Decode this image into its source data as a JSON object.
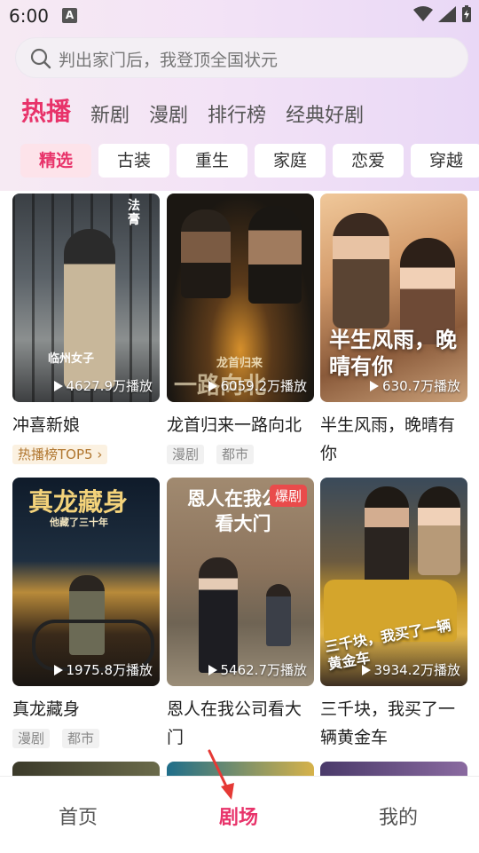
{
  "status_bar": {
    "time": "6:00",
    "notification_icon": "A"
  },
  "search": {
    "placeholder": "判出家门后，我登顶全国状元"
  },
  "tabs": [
    {
      "label": "热播",
      "active": true
    },
    {
      "label": "新剧"
    },
    {
      "label": "漫剧"
    },
    {
      "label": "排行榜"
    },
    {
      "label": "经典好剧"
    }
  ],
  "chips": [
    {
      "label": "精选",
      "active": true
    },
    {
      "label": "古装"
    },
    {
      "label": "重生"
    },
    {
      "label": "家庭"
    },
    {
      "label": "恋爱"
    },
    {
      "label": "穿越"
    }
  ],
  "cards": [
    {
      "title": "冲喜新娘",
      "plays": "4627.9万播放",
      "rank": "热播榜TOP5",
      "poster_text": "临州女子",
      "poster_side": "法膏"
    },
    {
      "title": "龙首归来一路向北",
      "plays": "6059.2万播放",
      "tags": [
        "漫剧",
        "都市"
      ],
      "poster_text": "龙首归来",
      "poster_big": "一路向北"
    },
    {
      "title": "半生风雨，晚晴有你",
      "plays": "630.7万播放",
      "poster_text": "半生风雨，晚晴有你"
    },
    {
      "title": "真龙藏身",
      "plays": "1975.8万播放",
      "tags": [
        "漫剧",
        "都市"
      ],
      "poster_text": "真龙藏身",
      "poster_sub": "他藏了三十年"
    },
    {
      "title": "恩人在我公司看大门",
      "plays": "5462.7万播放",
      "badge": "爆剧",
      "poster_text": "恩人在我公司看大门"
    },
    {
      "title": "三千块，我买了一辆黄金车",
      "plays": "3934.2万播放",
      "poster_text": "三千块，我买了一辆黄金车"
    }
  ],
  "bottom_nav": [
    {
      "label": "首页"
    },
    {
      "label": "剧场",
      "active": true
    },
    {
      "label": "我的"
    }
  ],
  "colors": {
    "accent": "#e8336a",
    "rank_text": "#b0762f",
    "badge": "#e94b4b"
  }
}
